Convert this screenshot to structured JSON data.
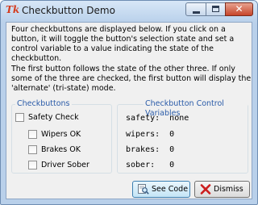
{
  "window": {
    "title": "Checkbutton Demo",
    "icon": "tk-feather-icon",
    "controls": {
      "minimize": "minimize-icon",
      "maximize": "maximize-icon",
      "close": "close-icon"
    }
  },
  "intro": "Four checkbuttons are displayed below.  If you click on a button, it will toggle the button's selection state and set a control variable to a value indicating the state of the checkbutton.",
  "note": "The first button follows the state of the other three. If only some of the three are checked, the first button will display the 'alternate' (tri-state) mode.",
  "checkbuttons": {
    "title": "Checkbuttons",
    "items": [
      {
        "label": "Safety Check",
        "checked": false
      },
      {
        "label": "Wipers OK",
        "checked": false
      },
      {
        "label": "Brakes OK",
        "checked": false
      },
      {
        "label": "Driver Sober",
        "checked": false
      }
    ]
  },
  "variables": {
    "title": "Checkbutton Control Variables",
    "rows": [
      "safety:  none",
      "wipers:  0",
      "brakes:  0",
      "sober:   0"
    ]
  },
  "buttons": {
    "see_code": "See Code",
    "dismiss": "Dismiss"
  },
  "colors": {
    "legend": "#2a5ba8",
    "dismiss_x": "#cc1d1d"
  }
}
